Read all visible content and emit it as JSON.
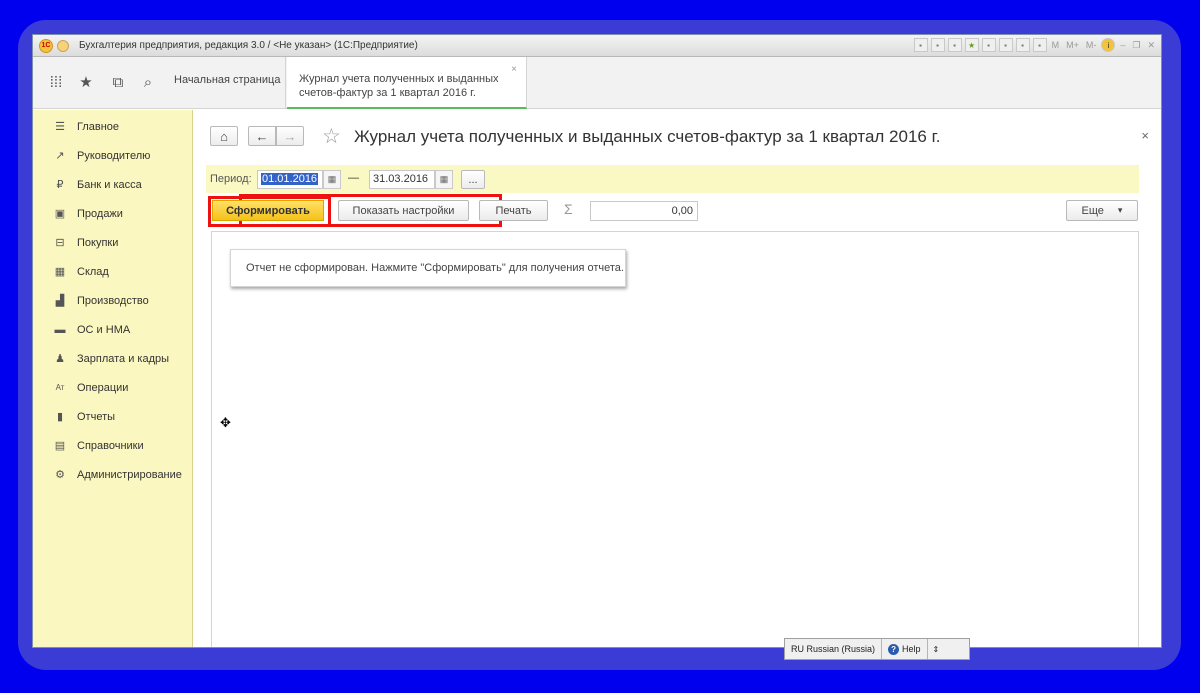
{
  "window": {
    "title": "Бухгалтерия предприятия, редакция 3.0 / <Не указан>  (1С:Предприятие)",
    "logo_text": "1С",
    "tools": [
      "save-icon",
      "print-icon",
      "preview-icon",
      "star-icon",
      "bookmark-icon",
      "calculator-icon",
      "calendar-icon",
      "table-icon"
    ],
    "memory_buttons": [
      "M",
      "M+",
      "M-"
    ],
    "info_icon": "i",
    "minimize": "‒",
    "restore": "❐",
    "close": "✕"
  },
  "toolbar": {
    "icons": [
      "apps-grid-icon",
      "favorites-star-icon",
      "history-icon",
      "search-icon"
    ],
    "home_tab": "Начальная страница",
    "active_tab_line1": "Журнал учета полученных и выданных",
    "active_tab_line2": "счетов-фактур за 1 квартал 2016 г.",
    "active_tab_close": "×"
  },
  "sidebar": {
    "items": [
      {
        "icon": "☰",
        "label": "Главное"
      },
      {
        "icon": "↗",
        "label": "Руководителю"
      },
      {
        "icon": "₽",
        "label": "Банк и касса"
      },
      {
        "icon": "▣",
        "label": "Продажи"
      },
      {
        "icon": "⊟",
        "label": "Покупки"
      },
      {
        "icon": "▦",
        "label": "Склад"
      },
      {
        "icon": "▟",
        "label": "Производство"
      },
      {
        "icon": "▬",
        "label": "ОС и НМА"
      },
      {
        "icon": "♟",
        "label": "Зарплата и кадры"
      },
      {
        "icon": "Ат",
        "label": "Операции"
      },
      {
        "icon": "▮",
        "label": "Отчеты"
      },
      {
        "icon": "▤",
        "label": "Справочники"
      },
      {
        "icon": "⚙",
        "label": "Администрирование"
      }
    ]
  },
  "main": {
    "home_button": "⌂",
    "back_button": "←",
    "forward_button": "→",
    "star": "☆",
    "title": "Журнал учета полученных и выданных счетов-фактур за 1 квартал 2016 г.",
    "close": "×",
    "period_label": "Период:",
    "date_from": "01.01.2016",
    "date_to": "31.03.2016",
    "dash": "—",
    "calendar_icon": "▦",
    "ellipsis_button": "...",
    "generate_button": "Сформировать",
    "settings_button": "Показать настройки",
    "print_button": "Печать",
    "sigma": "Σ",
    "sum_value": "0,00",
    "more_button": "Еще",
    "more_arrow": "▾",
    "report_message": "Отчет не сформирован. Нажмите \"Сформировать\" для получения отчета.",
    "cursor": "✥"
  },
  "statusbar": {
    "language": "RU Russian (Russia)",
    "help_icon": "?",
    "help": "Help",
    "arrow": "⇕"
  },
  "colors": {
    "background": "#0000ee",
    "sidebar": "#fbf7c0",
    "highlight_red": "#ee1111",
    "accent_yellow": "#f5c21b"
  }
}
